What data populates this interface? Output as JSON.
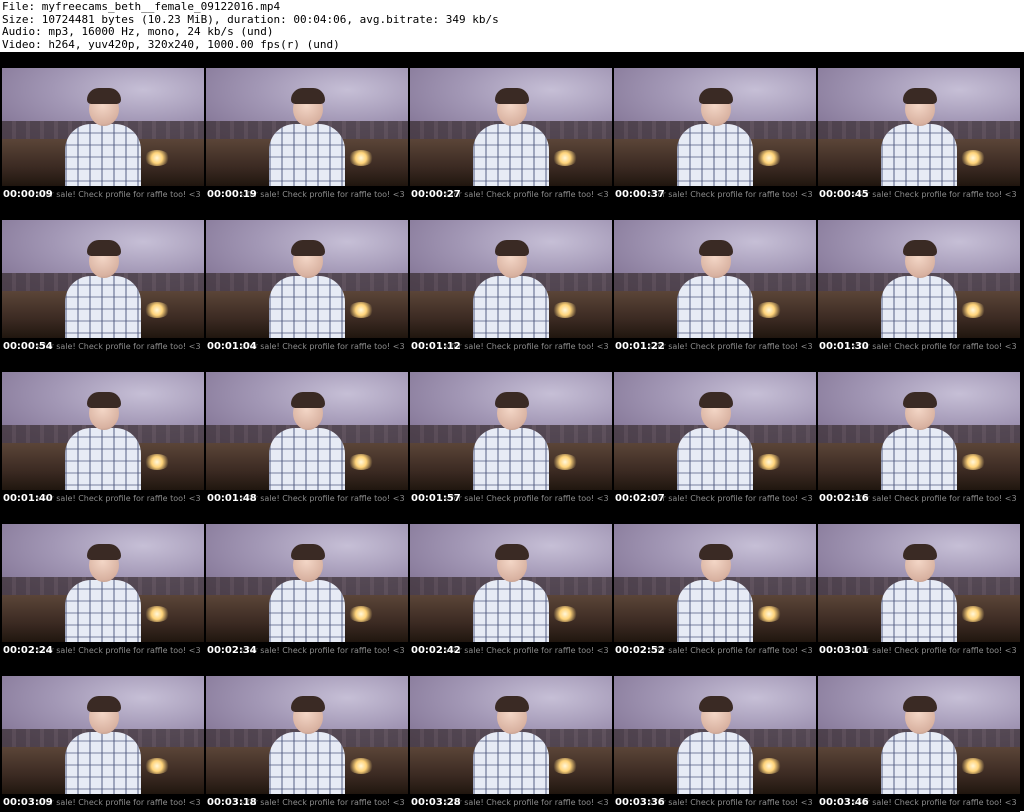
{
  "header": {
    "file_line": "File: myfreecams_beth__female_09122016.mp4",
    "size_line": "Size: 10724481 bytes (10.23 MiB), duration: 00:04:06, avg.bitrate: 349 kb/s",
    "audio_line": "Audio: mp3, 16000 Hz, mono, 24 kb/s (und)",
    "video_line": "Video: h264, yuv420p, 320x240, 1000.00 fps(r) (und)"
  },
  "overlay_text": "s for sale! Check profile for raffle too! <3",
  "thumbnails": [
    [
      "00:00:09",
      "00:00:19",
      "00:00:27",
      "00:00:37",
      "00:00:45"
    ],
    [
      "00:00:54",
      "00:01:04",
      "00:01:12",
      "00:01:22",
      "00:01:30"
    ],
    [
      "00:01:40",
      "00:01:48",
      "00:01:57",
      "00:02:07",
      "00:02:16"
    ],
    [
      "00:02:24",
      "00:02:34",
      "00:02:42",
      "00:02:52",
      "00:03:01"
    ],
    [
      "00:03:09",
      "00:03:18",
      "00:03:28",
      "00:03:36",
      "00:03:46"
    ]
  ]
}
